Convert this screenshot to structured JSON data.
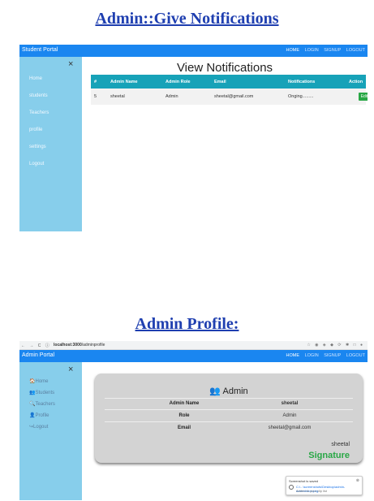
{
  "headings": {
    "first": "Admin::Give Notifications",
    "second": "Admin Profile:"
  },
  "notifications_screen": {
    "brand": "Student Portal",
    "top_menu": [
      "HOME",
      "LOGIN",
      "SIGNUP",
      "LOGOUT"
    ],
    "active_menu": "HOME",
    "sidebar_close": "×",
    "sidebar_items": [
      "Home",
      "students",
      "Teachers",
      "profile",
      "settings",
      "Logout"
    ],
    "title": "View Notifications",
    "table": {
      "columns": [
        "#",
        "Admin Name",
        "Admin Role",
        "Email",
        "Notifications",
        "Action"
      ],
      "rows": [
        {
          "id": "5",
          "name": "sheetal",
          "role": "Admin",
          "email": "sheetal@gmail.com",
          "notification": "Onging.........",
          "action": "Edit"
        }
      ]
    }
  },
  "profile_screen": {
    "browser": {
      "nav": "← → C ⓘ",
      "url_prefix": "localhost:3000",
      "url_path": "/adminprofile"
    },
    "brand": "Admin Portal",
    "top_menu": [
      "HOME",
      "LOGIN",
      "SIGNUP",
      "LOGOUT"
    ],
    "sidebar_close": "×",
    "sidebar_items": [
      {
        "icon": "home-icon",
        "glyph": "🏠",
        "label": "Home"
      },
      {
        "icon": "users-icon",
        "glyph": "👥",
        "label": "Students"
      },
      {
        "icon": "teacher-icon",
        "glyph": "🔍",
        "label": "Teachers"
      },
      {
        "icon": "profile-icon",
        "glyph": "👤",
        "label": "Profile"
      },
      {
        "icon": "logout-icon",
        "glyph": "↪",
        "label": "Logout"
      }
    ],
    "card": {
      "title_icon": "👥",
      "title": "Admin",
      "fields": [
        {
          "label": "Admin Name",
          "value": "sheetal",
          "bold": true
        },
        {
          "label": "Role",
          "value": "Admin",
          "bold": false
        },
        {
          "label": "Email",
          "value": "sheetal@gmail.com",
          "bold": false
        }
      ],
      "signature_name": "sheetal",
      "signature": "Signature"
    },
    "toast": {
      "title": "Screenshot is saved",
      "line1": "C:\\...\\screenshots\\Desktop\\admin-screenshot.png",
      "line2": "Added to your clip list"
    }
  },
  "colors": {
    "navbar": "#1a86f0",
    "sidebar": "#87ceeb",
    "table_header": "#17a2b8",
    "edit_button": "#28a745",
    "signature": "#28a745",
    "heading": "#1f3fb0"
  }
}
